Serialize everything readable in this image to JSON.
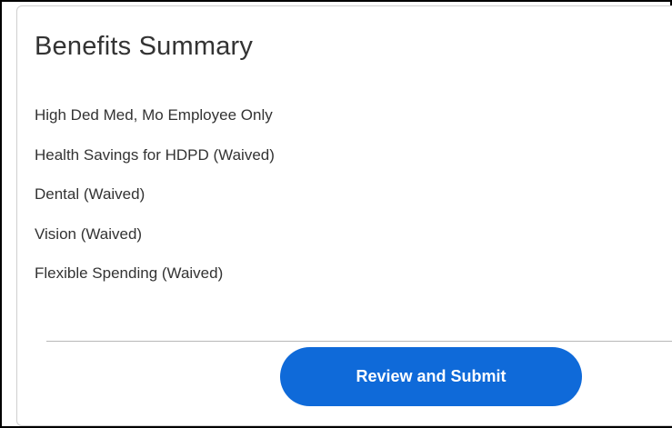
{
  "summary": {
    "title": "Benefits Summary",
    "items": [
      {
        "label": "High Ded Med, Mo Employee Only"
      },
      {
        "label": "Health Savings for HDPD (Waived)"
      },
      {
        "label": "Dental (Waived)"
      },
      {
        "label": "Vision (Waived)"
      },
      {
        "label": "Flexible Spending (Waived)"
      }
    ],
    "submit_label": "Review and Submit"
  },
  "colors": {
    "button_bg": "#0f6ad9",
    "button_text": "#ffffff",
    "text": "#333333"
  }
}
